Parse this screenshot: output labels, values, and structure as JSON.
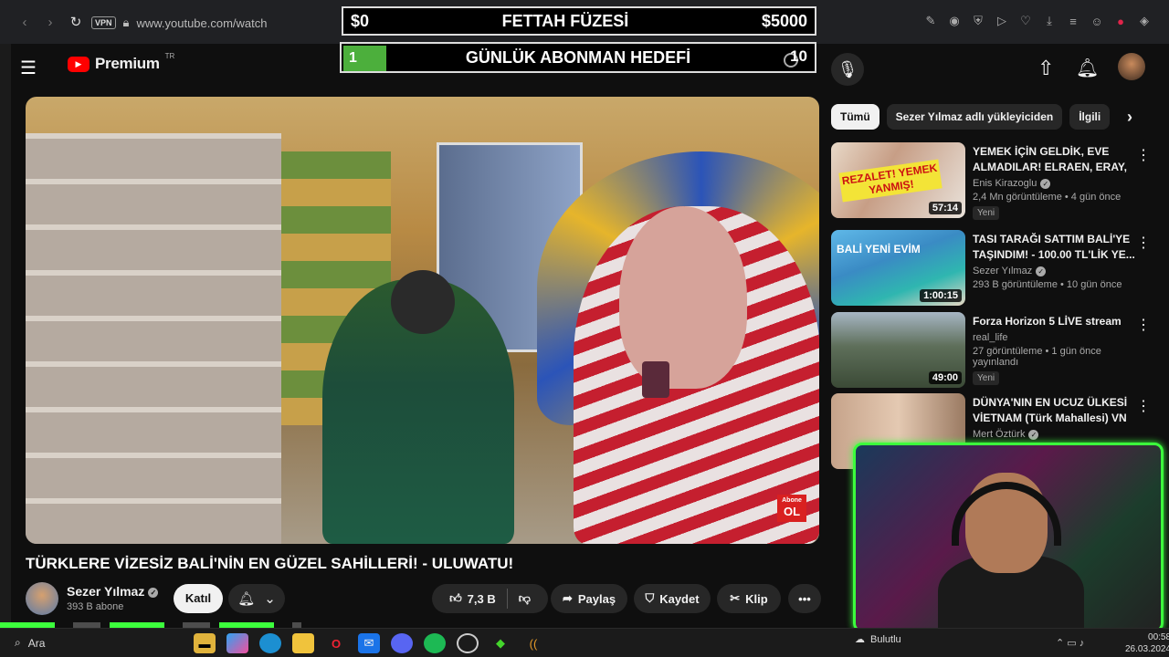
{
  "browser": {
    "url": "www.youtube.com/watch",
    "vpn_label": "VPN",
    "extension_icons": [
      "edit-icon",
      "camera-icon",
      "shield-icon",
      "send-icon",
      "heart-icon",
      "download-icon",
      "menu-icon",
      "profile-icon",
      "record-icon",
      "cube-icon"
    ]
  },
  "youtube": {
    "logo_text": "Premium",
    "country_code": "TR"
  },
  "overlay": {
    "left_amount": "$0",
    "title": "FETTAH FÜZESİ",
    "right_amount": "$5000",
    "goal_current": "1",
    "goal_title": "GÜNLÜK ABONMAN HEDEFİ",
    "goal_target": "10",
    "goal_progress": 0.1
  },
  "video": {
    "title": "TÜRKLERE VİZESİZ BALİ'NİN EN GÜZEL SAHİLLERİ! - ULUWATU!",
    "abone_small": "Abone",
    "abone_big": "OL",
    "channel": "Sezer Yılmaz",
    "subscribers": "393 B abone",
    "join_label": "Katıl",
    "likes": "7,3 B",
    "share_label": "Paylaş",
    "save_label": "Kaydet",
    "clip_label": "Klip",
    "more_label": "•••"
  },
  "sidebar_tabs": [
    "Tümü",
    "Sezer Yılmaz adlı yükleyiciden",
    "İlgili"
  ],
  "recommendations": [
    {
      "title": "YEMEK İÇİN GELDİK, EVE ALMADILAR! ELRAEN, ERAY, ...",
      "channel": "Enis Kirazoglu",
      "meta": "2,4 Mn görüntüleme • 4 gün önce",
      "badge": "Yeni",
      "duration": "57:14",
      "thumb_text": "REZALET! YEMEK YANMIŞ!"
    },
    {
      "title": "TASI TARAĞI SATTIM BALİ'YE TAŞINDIM! - 100.00 TL'LİK YE...",
      "channel": "Sezer Yılmaz",
      "meta": "293 B görüntüleme • 10 gün önce",
      "badge": "",
      "duration": "1:00:15",
      "thumb_text": "BALİ YENİ EVİM"
    },
    {
      "title": "Forza Horizon 5  LİVE stream",
      "channel": "real_life",
      "meta": "27 görüntüleme • 1 gün önce yayınlandı",
      "badge": "Yeni",
      "duration": "49:00",
      "thumb_text": ""
    },
    {
      "title": "DÜNYA'NIN EN UCUZ ÜLKESİ VİETNAM (Türk Mahallesi) VN",
      "channel": "Mert Öztürk",
      "meta": "",
      "badge": "",
      "duration": "",
      "thumb_text": ""
    }
  ],
  "taskbar": {
    "search_label": "Ara",
    "weather_label": "Bulutlu",
    "time": "00:58",
    "date": "26.03.2024"
  }
}
